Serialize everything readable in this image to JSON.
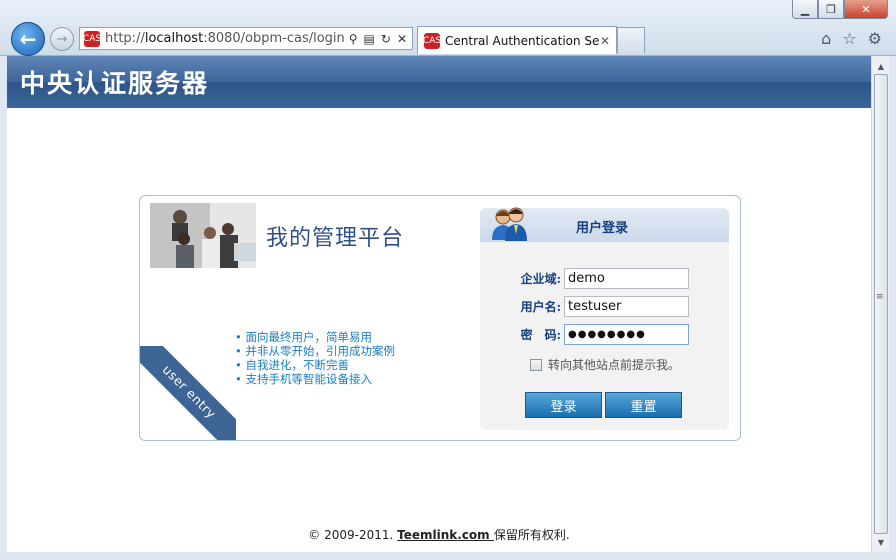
{
  "browser": {
    "url_prefix": "http://",
    "url_host": "localhost",
    "url_rest": ":8080/obpm-cas/login",
    "tab_title": "Central Authentication Se...",
    "favicon_text": "CAS"
  },
  "banner": {
    "title": "中央认证服务器"
  },
  "panel": {
    "platform_title": "我的管理平台",
    "features": [
      "面向最终用户，简单易用",
      "并非从零开始，引用成功案例",
      "自我进化，不断完善",
      "支持手机等智能设备接入"
    ],
    "ribbon_text": "user entry"
  },
  "login": {
    "title": "用户登录",
    "domain_label": "企业域:",
    "domain_value": "demo",
    "username_label": "用户名:",
    "username_value": "testuser",
    "password_label": "密　码:",
    "password_value": "●●●●●●●●",
    "remember_label": "转向其他站点前提示我。",
    "login_button": "登录",
    "reset_button": "重置"
  },
  "footer": {
    "prefix": "© 2009-2011. ",
    "link": "Teemlink.com ",
    "suffix": "保留所有权利."
  },
  "colors": {
    "banner": "#3e6597",
    "link_blue": "#1a7ec0",
    "button": "#1b6fad"
  }
}
